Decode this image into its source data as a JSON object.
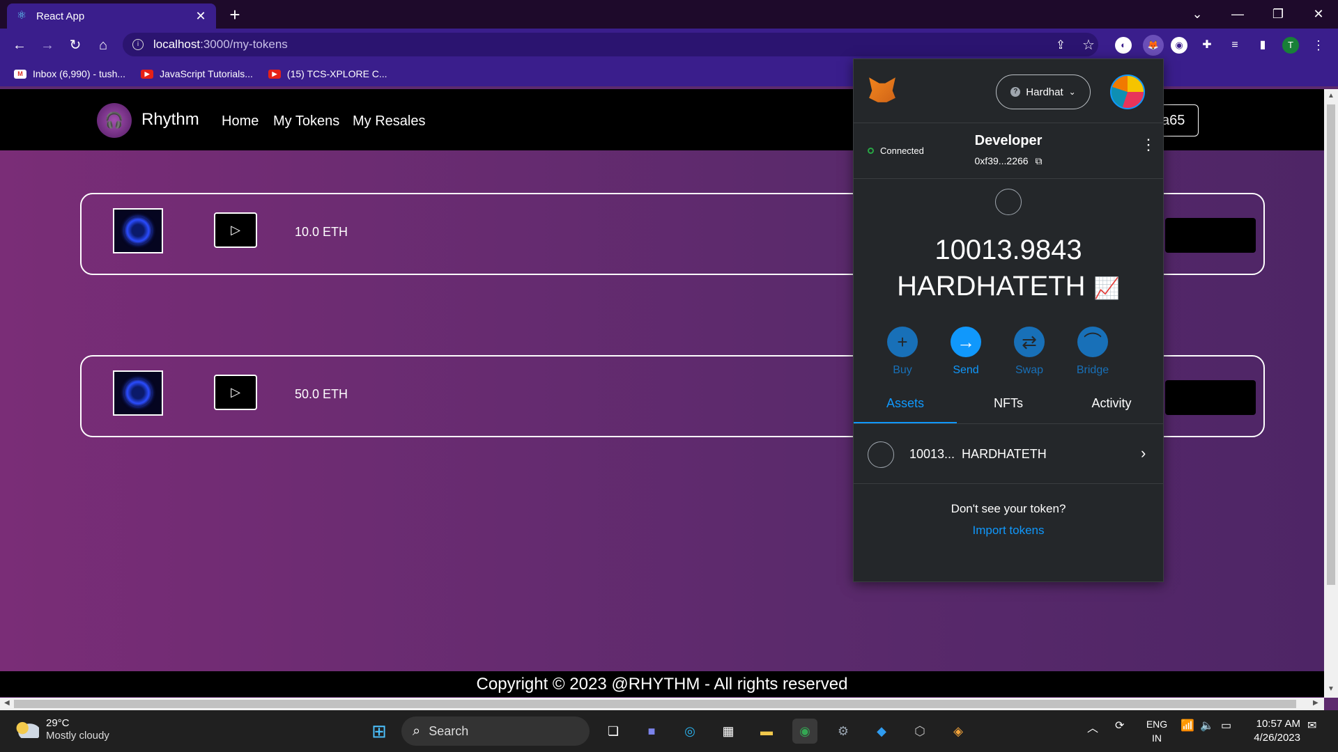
{
  "browser": {
    "tab_title": "React App",
    "tab_close": "✕",
    "new_tab": "+",
    "url_host": "localhost",
    "url_path": ":3000/my-tokens",
    "profile_initial": "T",
    "bookmarks": [
      {
        "icon": "gmail",
        "label": "Inbox (6,990) - tush..."
      },
      {
        "icon": "youtube",
        "label": "JavaScript Tutorials..."
      },
      {
        "icon": "youtube",
        "label": "(15) TCS-XPLORE C..."
      }
    ]
  },
  "app": {
    "brand": "Rhythm",
    "nav": [
      "Home",
      "My Tokens",
      "My Resales"
    ],
    "account_suffix": "a65",
    "tokens": [
      {
        "price": "10.0 ETH"
      },
      {
        "price": "50.0 ETH"
      }
    ],
    "footer": "Copyright © 2023 @RHYTHM - All rights reserved"
  },
  "metamask": {
    "network": "Hardhat",
    "status": "Connected",
    "account_name": "Developer",
    "account_address": "0xf39...2266",
    "balance": "10013.9843",
    "balance_unit": "HARDHATETH",
    "actions": [
      {
        "label": "Buy",
        "icon": "plus-icon",
        "active": false
      },
      {
        "label": "Send",
        "icon": "arrow-right-icon",
        "active": true
      },
      {
        "label": "Swap",
        "icon": "swap-icon",
        "active": false
      },
      {
        "label": "Bridge",
        "icon": "bridge-icon",
        "active": false
      }
    ],
    "tabs": [
      "Assets",
      "NFTs",
      "Activity"
    ],
    "active_tab": "Assets",
    "asset_row": "10013...  HARDHATETH",
    "no_token_text": "Don't see your token?",
    "import_link": "Import tokens",
    "colors": {
      "accent": "#1098fc",
      "bg": "#24272a"
    }
  },
  "taskbar": {
    "temperature": "29°C",
    "weather": "Mostly cloudy",
    "search_label": "Search",
    "lang_top": "ENG",
    "lang_bottom": "IN",
    "time": "10:57 AM",
    "date": "4/26/2023"
  }
}
